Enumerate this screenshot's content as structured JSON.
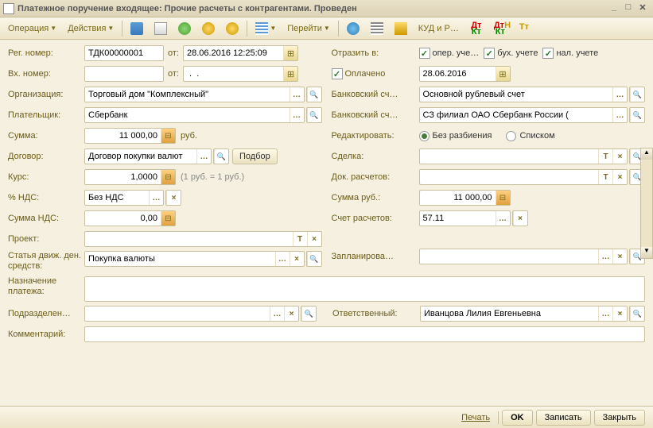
{
  "title": "Платежное поручение входящее: Прочие расчеты с контрагентами. Проведен",
  "toolbar": {
    "operation": "Операция",
    "actions": "Действия",
    "goto": "Перейти",
    "kudir": "КУД и Р…"
  },
  "left": {
    "reg_num_lbl": "Рег. номер:",
    "reg_num": "ТДК00000001",
    "ot": "от:",
    "reg_date": "28.06.2016 12:25:09",
    "in_num_lbl": "Вх. номер:",
    "in_num": "",
    "in_date": " .  .",
    "org_lbl": "Организация:",
    "org": "Торговый дом \"Комплексный\"",
    "payer_lbl": "Плательщик:",
    "payer": "Сбербанк",
    "sum_lbl": "Сумма:",
    "sum": "11 000,00",
    "currency": "руб.",
    "contract_lbl": "Договор:",
    "contract": "Договор покупки валют",
    "podbor": "Подбор",
    "rate_lbl": "Курс:",
    "rate": "1,0000",
    "rate_note": "(1 руб. = 1 руб.)",
    "vat_pct_lbl": "% НДС:",
    "vat_pct": "Без НДС",
    "vat_sum_lbl": "Сумма НДС:",
    "vat_sum": "0,00",
    "project_lbl": "Проект:",
    "project": "",
    "cashflow_lbl": "Статья движ. ден. средств:",
    "cashflow": "Покупка валюты",
    "purpose_lbl": "Назначение платежа:",
    "purpose": "",
    "dept_lbl": "Подразделен…",
    "dept": "",
    "comment_lbl": "Комментарий:",
    "comment": ""
  },
  "right": {
    "reflect_lbl": "Отразить в:",
    "chk_oper": "опер. уче…",
    "chk_buh": "бух. учете",
    "chk_nal": "нал. учете",
    "paid_lbl": "Оплачено",
    "paid_date": "28.06.2016",
    "bank_acc_lbl": "Банковский сч…",
    "bank_acc": "Основной рублевый счет",
    "bank_acc2_lbl": "Банковский сч…",
    "bank_acc2": "СЗ филиал ОАО Сбербанк России (",
    "edit_lbl": "Редактировать:",
    "radio1": "Без разбиения",
    "radio2": "Списком",
    "deal_lbl": "Сделка:",
    "deal": "",
    "settledoc_lbl": "Док. расчетов:",
    "settledoc": "",
    "sum_rub_lbl": "Сумма руб.:",
    "sum_rub": "11 000,00",
    "acc_lbl": "Счет расчетов:",
    "acc": "57.11",
    "planned_lbl": "Запланирова…",
    "planned": "",
    "resp_lbl": "Ответственный:",
    "resp": "Иванцова Лилия Евгеньевна"
  },
  "footer": {
    "print": "Печать",
    "ok": "OK",
    "save": "Записать",
    "close": "Закрыть"
  }
}
